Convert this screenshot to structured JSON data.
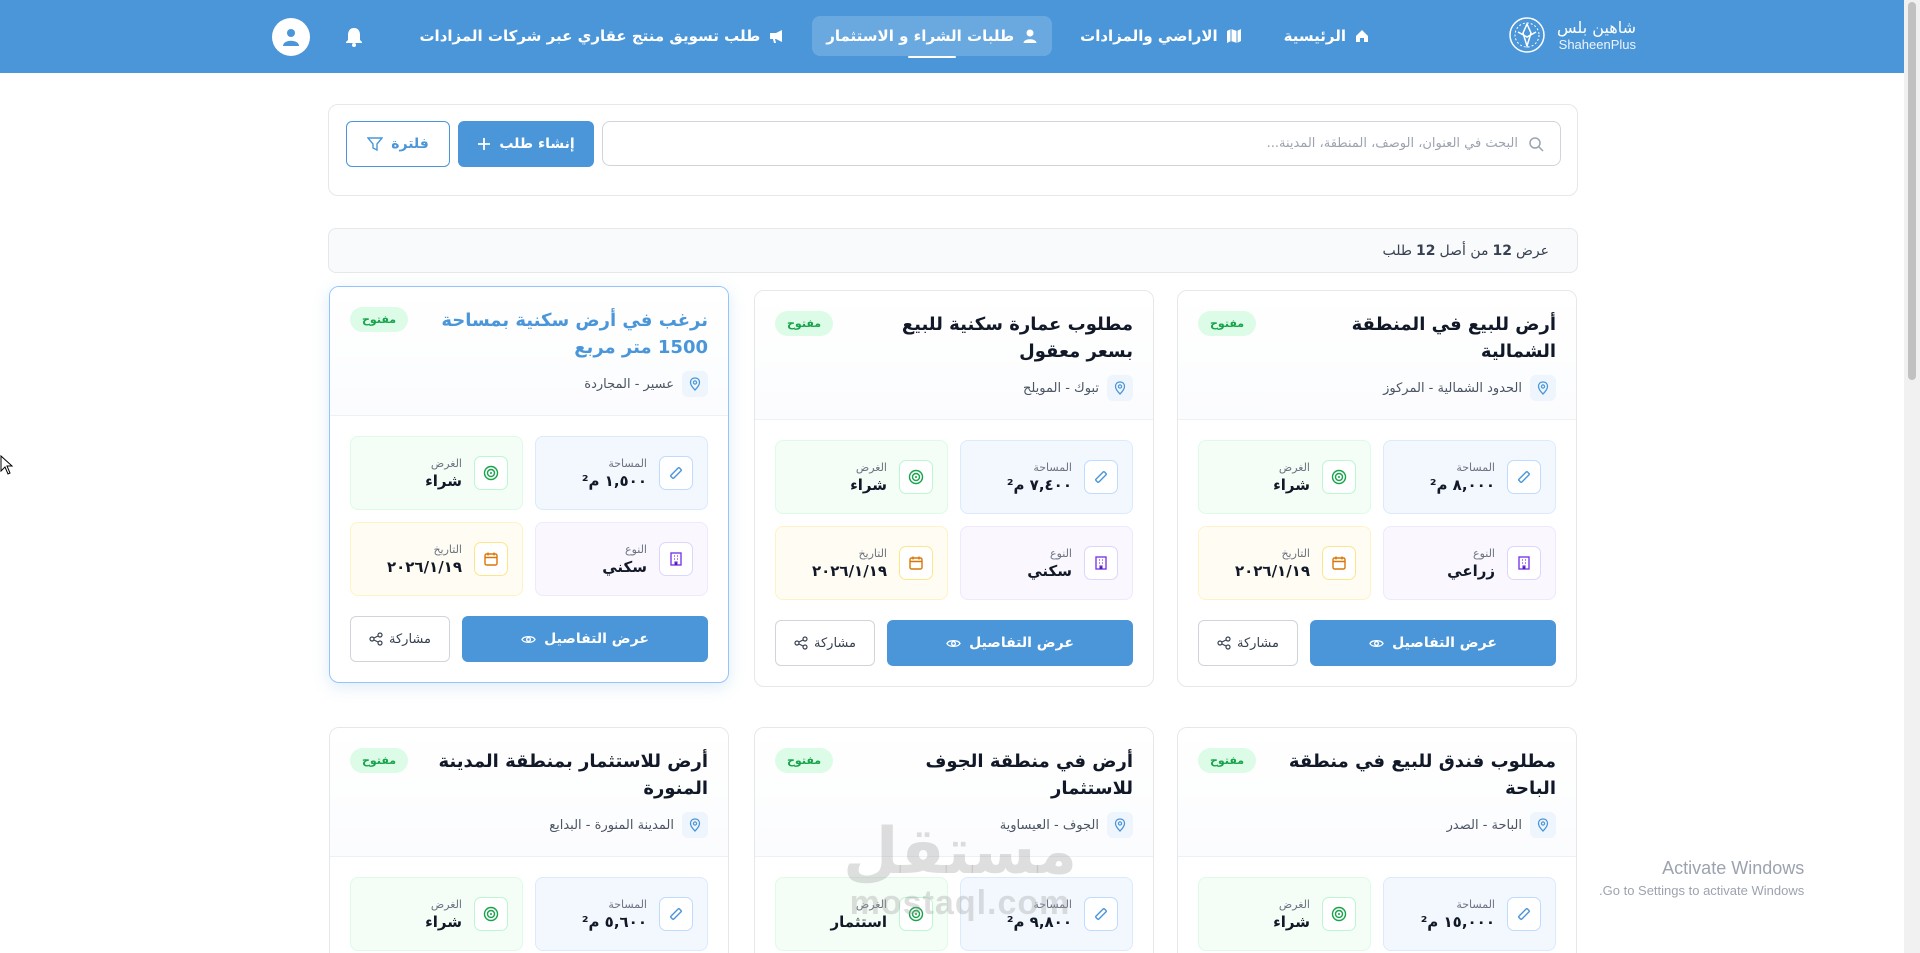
{
  "brand": {
    "name_ar": "شاهين بلس",
    "name_en": "ShaheenPlus"
  },
  "nav": [
    {
      "label": "الرئيسية",
      "icon": "home-icon"
    },
    {
      "label": "الاراضي والمزادات",
      "icon": "map-icon"
    },
    {
      "label": "طلبات الشراء و الاستثمار",
      "icon": "user-icon",
      "active": true
    },
    {
      "label": "طلب تسويق منتج عقاري عبر شركات المزادات",
      "icon": "megaphone-icon"
    }
  ],
  "search": {
    "placeholder": "البحث في العنوان، الوصف، المنطقة، المدينة..."
  },
  "toolbar": {
    "create_label": "إنشاء طلب",
    "filter_label": "فلترة"
  },
  "count": {
    "prefix": "عرض",
    "shown": "12",
    "middle": "من أصل",
    "total": "12",
    "suffix": "طلب"
  },
  "labels": {
    "area": "المساحة",
    "purpose": "الغرض",
    "type": "النوع",
    "date": "التاريخ",
    "details": "عرض التفاصيل",
    "share": "مشاركة",
    "status_open": "مفتوح"
  },
  "cards": [
    {
      "title": "أرض للبيع في المنطقة الشمالية",
      "location": "الحدود الشمالية - المركوز",
      "area": "٨,٠٠٠ م²",
      "purpose": "شراء",
      "type": "زراعي",
      "date": "٢٠٢٦/١/١٩"
    },
    {
      "title": "مطلوب عمارة سكنية للبيع بسعر معقول",
      "location": "تبوك - المويلح",
      "area": "٧,٤٠٠ م²",
      "purpose": "شراء",
      "type": "سكني",
      "date": "٢٠٢٦/١/١٩"
    },
    {
      "title": "نرغب في أرض سكنية بمساحة 1500 متر مربع",
      "location": "عسير - المجاردة",
      "area": "١,٥٠٠ م²",
      "purpose": "شراء",
      "type": "سكني",
      "date": "٢٠٢٦/١/١٩"
    },
    {
      "title": "مطلوب فندق للبيع في منطقة الباحة",
      "location": "الباحة - الصدر",
      "area": "١٥,٠٠٠ م²",
      "purpose": "شراء"
    },
    {
      "title": "أرض في منطقة الجوف للاستثمار",
      "location": "الجوف - العيساوية",
      "area": "٩,٨٠٠ م²",
      "purpose": "استثمار"
    },
    {
      "title": "أرض للاستثمار بمنطقة المدينة المنورة",
      "location": "المدينة المنورة - البدايع",
      "area": "٥,٦٠٠ م²",
      "purpose": "شراء"
    }
  ],
  "watermark": {
    "windows_title": "Activate Windows",
    "windows_sub": "Go to Settings to activate Windows.",
    "mostaql_ar": "مستقل",
    "mostaql_en": "mostaql.com"
  },
  "colors": {
    "primary": "#4a96d9",
    "badge_green": "#16a34a"
  }
}
